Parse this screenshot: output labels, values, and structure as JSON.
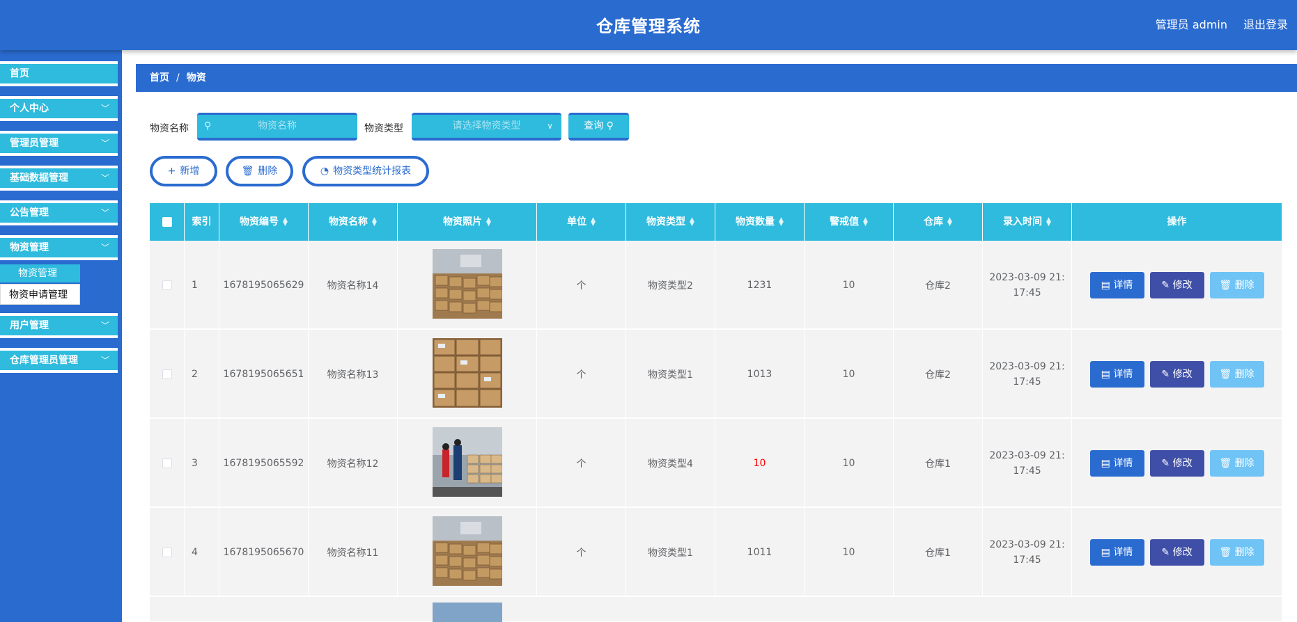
{
  "header": {
    "title": "仓库管理系统",
    "user": "管理员 admin",
    "logout": "退出登录"
  },
  "sidebar": {
    "items": [
      {
        "label": "首页"
      },
      {
        "label": "个人中心"
      },
      {
        "label": "管理员管理"
      },
      {
        "label": "基础数据管理"
      },
      {
        "label": "公告管理"
      },
      {
        "label": "物资管理"
      },
      {
        "label": "用户管理"
      },
      {
        "label": "仓库管理员管理"
      }
    ],
    "submenu": [
      {
        "label": "物资管理"
      },
      {
        "label": "物资申请管理"
      }
    ]
  },
  "breadcrumb": {
    "home": "首页",
    "sep": "/",
    "current": "物资"
  },
  "search": {
    "name_label": "物资名称",
    "name_placeholder": "物资名称",
    "type_label": "物资类型",
    "type_placeholder": "请选择物资类型",
    "query_label": "查询"
  },
  "toolbar": {
    "add_label": "新增",
    "delete_label": "删除",
    "report_label": "物资类型统计报表"
  },
  "table": {
    "columns": [
      "索引",
      "物资编号",
      "物资名称",
      "物资照片",
      "单位",
      "物资类型",
      "物资数量",
      "警戒值",
      "仓库",
      "录入时间",
      "操作"
    ],
    "rows": [
      {
        "index": "1",
        "code": "1678195065629",
        "name": "物资名称14",
        "unit": "个",
        "type": "物资类型2",
        "qty": "1231",
        "warn": "10",
        "warehouse": "仓库2",
        "time1": "2023-03-09 21:",
        "time2": "17:45",
        "photo": "boxes"
      },
      {
        "index": "2",
        "code": "1678195065651",
        "name": "物资名称13",
        "unit": "个",
        "type": "物资类型1",
        "qty": "1013",
        "warn": "10",
        "warehouse": "仓库2",
        "time1": "2023-03-09 21:",
        "time2": "17:45",
        "photo": "boxes-close"
      },
      {
        "index": "3",
        "code": "1678195065592",
        "name": "物资名称12",
        "unit": "个",
        "type": "物资类型4",
        "qty": "10",
        "warn": "10",
        "warehouse": "仓库1",
        "time1": "2023-03-09 21:",
        "time2": "17:45",
        "photo": "workers"
      },
      {
        "index": "4",
        "code": "1678195065670",
        "name": "物资名称11",
        "unit": "个",
        "type": "物资类型1",
        "qty": "1011",
        "warn": "10",
        "warehouse": "仓库1",
        "time1": "2023-03-09 21:",
        "time2": "17:45",
        "photo": "boxes"
      }
    ],
    "actions": {
      "detail": "详情",
      "edit": "修改",
      "delete": "删除"
    }
  },
  "colors": {
    "primary": "#2a6bd0",
    "accent": "#2ebbdd",
    "edit": "#3f4fa8",
    "delete": "#6fc3f5",
    "warning_text": "#ff0000"
  }
}
